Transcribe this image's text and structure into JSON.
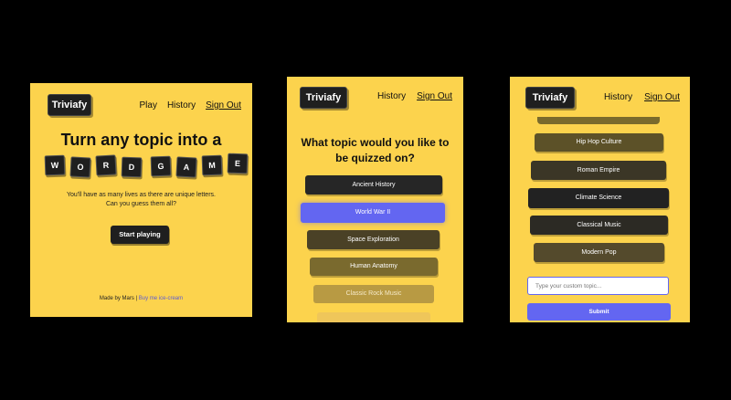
{
  "screen1": {
    "logo": "Triviafy",
    "nav": [
      "Play",
      "History",
      "Sign Out"
    ],
    "headline": "Turn any topic into a",
    "tiles": [
      "W",
      "O",
      "R",
      "D",
      "G",
      "A",
      "M",
      "E"
    ],
    "sub_line1": "You'll have as many lives as there are unique letters.",
    "sub_line2": "Can you guess them all?",
    "start_button": "Start playing",
    "footer_text": "Made by Mars | ",
    "footer_link": "Buy me ice-cream"
  },
  "screen2": {
    "logo": "Triviafy",
    "nav": [
      "History",
      "Sign Out"
    ],
    "question": "What topic would you like to be quizzed on?",
    "options": [
      "Ancient History",
      "World War II",
      "Space Exploration",
      "Human Anatomy",
      "Classic Rock Music"
    ],
    "selected_option": "World War II"
  },
  "screen3": {
    "logo": "Triviafy",
    "nav": [
      "History",
      "Sign Out"
    ],
    "options": [
      "Hip Hop Culture",
      "Roman Empire",
      "Climate Science",
      "Classical Music",
      "Modern Pop"
    ],
    "custom_placeholder": "Type your custom topic...",
    "submit": "Submit"
  },
  "colors": {
    "background": "#fcd34d",
    "dark": "#1f1f1f",
    "accent": "#6366f1"
  }
}
